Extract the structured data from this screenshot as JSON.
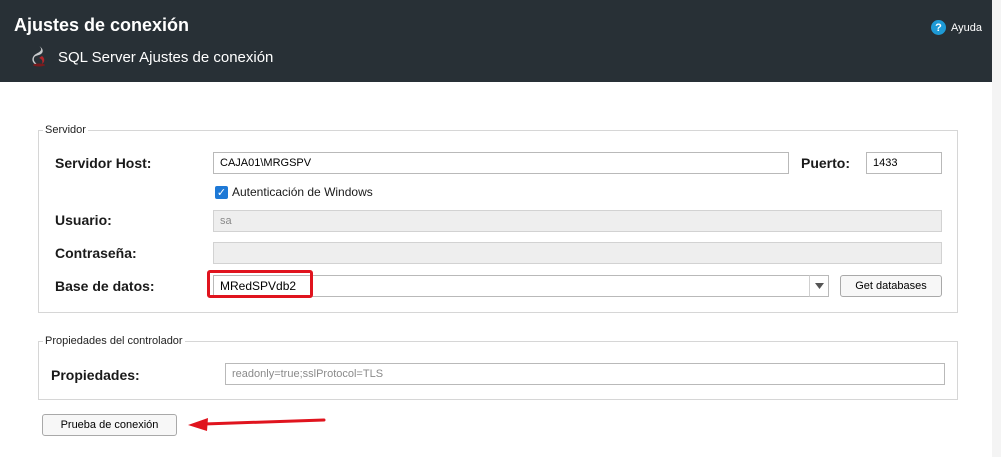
{
  "header": {
    "title": "Ajustes de conexión",
    "subtitle": "SQL Server  Ajustes de conexión",
    "help_label": "Ayuda",
    "help_glyph": "?",
    "background": "#283036"
  },
  "servidor": {
    "legend": "Servidor",
    "host_label": "Servidor Host:",
    "host_value": "CAJA01\\MRGSPV",
    "port_label": "Puerto:",
    "port_value": "1433",
    "windows_auth_label": "Autenticación de Windows",
    "windows_auth_checked": true,
    "user_label": "Usuario:",
    "user_value": "sa",
    "password_label": "Contraseña:",
    "password_value": "",
    "database_label": "Base de datos:",
    "database_value": "MRedSPVdb2",
    "get_databases_label": "Get databases"
  },
  "propiedades": {
    "legend": "Propiedades del controlador",
    "label": "Propiedades:",
    "value": "readonly=true;sslProtocol=TLS"
  },
  "test_button_label": "Prueba de conexión",
  "annotation_color": "#e0141e"
}
